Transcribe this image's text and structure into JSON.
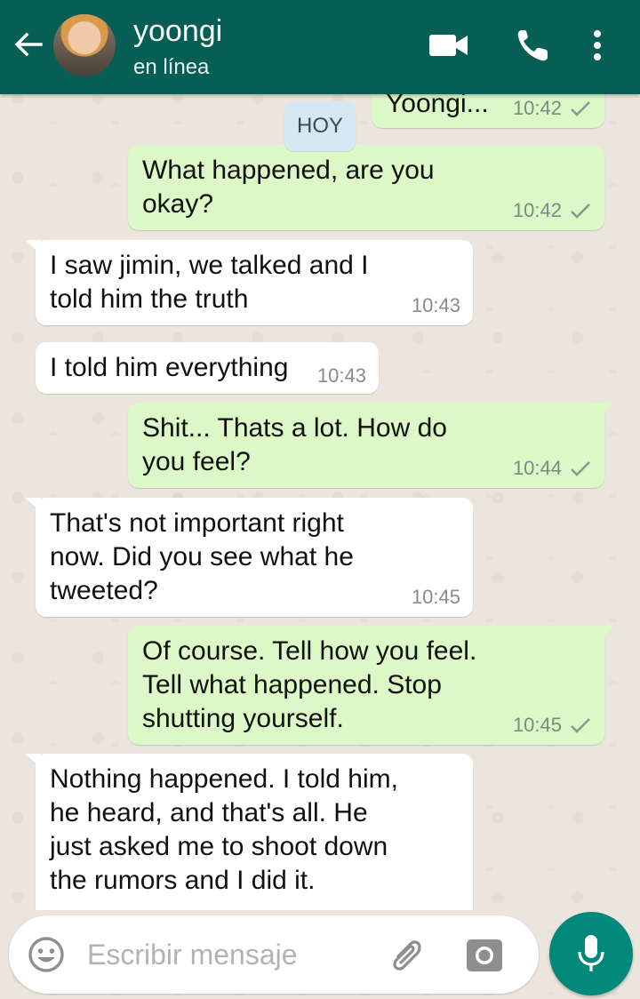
{
  "header": {
    "contact_name": "yoongi",
    "status": "en línea",
    "color": "#075e54"
  },
  "day_chip": "HOY",
  "messages": [
    {
      "direction": "out",
      "text": "Yoongi...",
      "time": "10:42",
      "ticks": "sent"
    },
    {
      "direction": "out",
      "text": "What happened, are you okay?",
      "time": "10:42",
      "ticks": "sent"
    },
    {
      "direction": "in",
      "text": "I saw jimin, we talked and I told him the truth",
      "time": "10:43"
    },
    {
      "direction": "in",
      "text": "I told him everything",
      "time": "10:43"
    },
    {
      "direction": "out",
      "text": "Shit... Thats a lot. How do you feel?",
      "time": "10:44",
      "ticks": "sent"
    },
    {
      "direction": "in",
      "text": "That's not important right now. Did you see what he tweeted?",
      "time": "10:45"
    },
    {
      "direction": "out",
      "text": "Of course. Tell how you feel. Tell what happened. Stop shutting yourself.",
      "time": "10:45",
      "ticks": "sent"
    },
    {
      "direction": "in",
      "text": "Nothing happened. I told him, he heard, and that's all. He just asked me to shoot down the rumors and I did it.",
      "time": ""
    }
  ],
  "composer": {
    "placeholder": "Escribir mensaje"
  },
  "icons": {
    "back": "arrow-left-icon",
    "video": "video-call-icon",
    "call": "phone-icon",
    "more": "more-vert-icon",
    "emoji": "emoji-icon",
    "attach": "paperclip-icon",
    "camera": "camera-icon",
    "mic": "microphone-icon"
  },
  "colors": {
    "outgoing_bubble": "#dcf8c6",
    "incoming_bubble": "#ffffff",
    "wallpaper": "#ece5dd",
    "accent": "#00897b"
  }
}
